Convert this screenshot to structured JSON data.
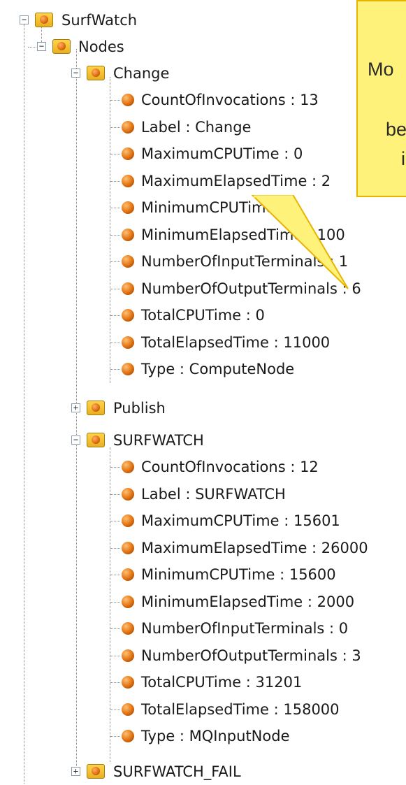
{
  "tree": {
    "root": {
      "label": "SurfWatch",
      "expander": "−"
    },
    "nodes_folder": {
      "label": "Nodes",
      "expander": "−"
    },
    "change": {
      "label": "Change",
      "expander": "−",
      "properties": [
        "CountOfInvocations : 13",
        "Label : Change",
        "MaximumCPUTime : 0",
        "MaximumElapsedTime : 2",
        "MinimumCPUTime : 0",
        "MinimumElapsedTime : 100",
        "NumberOfInputTerminals : 1",
        "NumberOfOutputTerminals : 6",
        "TotalCPUTime : 0",
        "TotalElapsedTime : 11000",
        "Type : ComputeNode"
      ]
    },
    "publish": {
      "label": "Publish",
      "expander": "+"
    },
    "surfwatch": {
      "label": "SURFWATCH",
      "expander": "−",
      "properties": [
        "CountOfInvocations : 12",
        "Label : SURFWATCH",
        "MaximumCPUTime : 15601",
        "MaximumElapsedTime : 26000",
        "MinimumCPUTime : 15600",
        "MinimumElapsedTime : 2000",
        "NumberOfInputTerminals : 0",
        "NumberOfOutputTerminals : 3",
        "TotalCPUTime : 31201",
        "TotalElapsedTime : 158000",
        "Type : MQInputNode"
      ]
    },
    "surfwatch_fail": {
      "label": "SURFWATCH_FAIL",
      "expander": "+"
    }
  },
  "callout": {
    "lines": [
      "Mo",
      "be",
      "in"
    ]
  },
  "colors": {
    "callout_fill": "#fff27a",
    "callout_border": "#e9b400",
    "folder": "#f2c230",
    "property_ball": "#e07010"
  },
  "icons": {
    "folder": "folder-icon",
    "property": "property-ball-icon"
  }
}
